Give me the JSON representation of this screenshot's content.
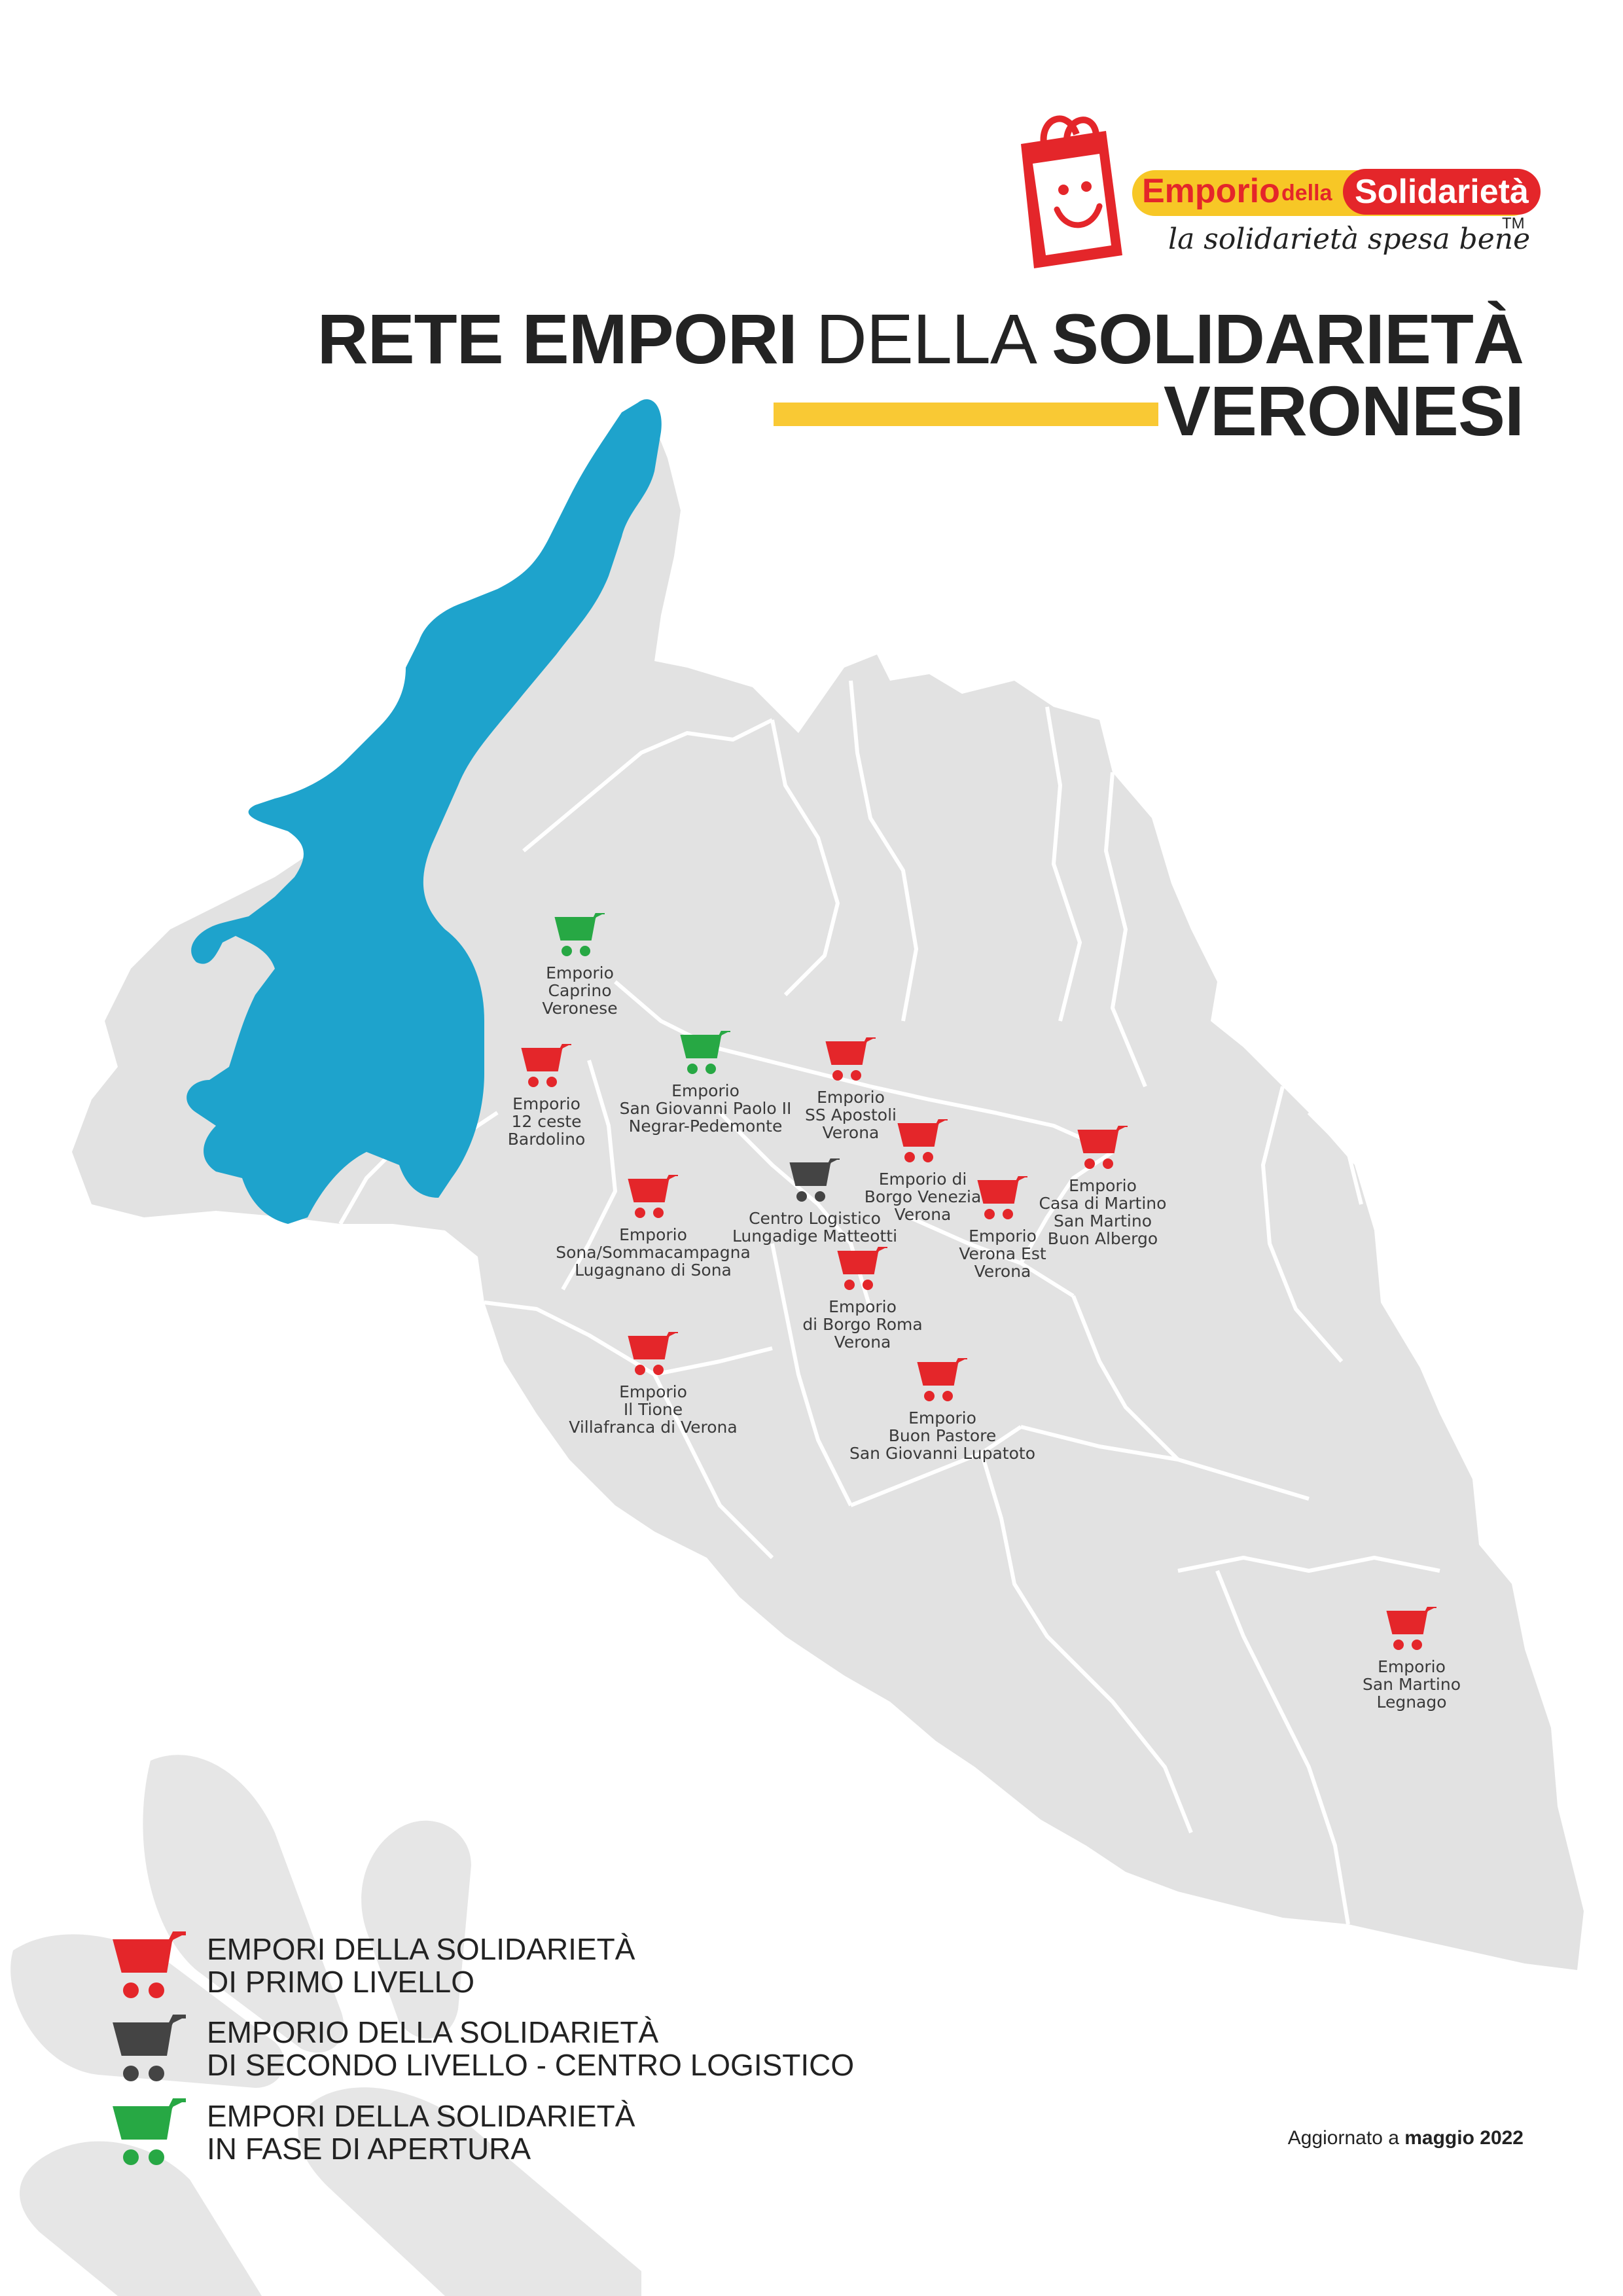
{
  "brand": {
    "word_emporio": "Emporio",
    "word_della": "della",
    "word_solidarieta": "Solidarietà",
    "tagline": "la solidarietà spesa bene",
    "trademark": "TM"
  },
  "title": {
    "line1_bold_a": "RETE EMPORI",
    "line1_light": "DELLA",
    "line1_bold_b": "SOLIDARIETÀ",
    "line2": "VERONESI"
  },
  "colors": {
    "primo_livello": "#e4262a",
    "secondo_livello": "#444444",
    "in_apertura": "#27a844",
    "lake": "#1ea3cc",
    "land": "#e2e2e2",
    "accent_bar": "#f9c934"
  },
  "locations": [
    {
      "level": "in_apertura",
      "lines": [
        "Emporio",
        "Caprino",
        "Veronese"
      ]
    },
    {
      "level": "primo_livello",
      "lines": [
        "Emporio",
        "12 ceste",
        "Bardolino"
      ]
    },
    {
      "level": "in_apertura",
      "lines": [
        "Emporio",
        "San Giovanni Paolo II",
        "Negrar-Pedemonte"
      ]
    },
    {
      "level": "primo_livello",
      "lines": [
        "Emporio",
        "SS Apostoli",
        "Verona"
      ]
    },
    {
      "level": "primo_livello",
      "lines": [
        "Emporio di",
        "Borgo Venezia",
        "Verona"
      ]
    },
    {
      "level": "primo_livello",
      "lines": [
        "Emporio",
        "Casa di Martino",
        "San Martino",
        "Buon Albergo"
      ]
    },
    {
      "level": "secondo_livello",
      "lines": [
        "Centro Logistico",
        "Lungadige Matteotti"
      ]
    },
    {
      "level": "primo_livello",
      "lines": [
        "Emporio",
        "Sona/Sommacampagna",
        "Lugagnano di Sona"
      ]
    },
    {
      "level": "primo_livello",
      "lines": [
        "Emporio",
        "Verona Est",
        "Verona"
      ]
    },
    {
      "level": "primo_livello",
      "lines": [
        "Emporio",
        "di Borgo Roma",
        "Verona"
      ]
    },
    {
      "level": "primo_livello",
      "lines": [
        "Emporio",
        "Il Tione",
        "Villafranca di Verona"
      ]
    },
    {
      "level": "primo_livello",
      "lines": [
        "Emporio",
        "Buon Pastore",
        "San Giovanni Lupatoto"
      ]
    },
    {
      "level": "primo_livello",
      "lines": [
        "Emporio",
        "San Martino",
        "Legnago"
      ]
    }
  ],
  "legend": [
    {
      "level": "primo_livello",
      "icon": "cart-icon-red",
      "lines": [
        "EMPORI DELLA SOLIDARIETÀ",
        "DI PRIMO LIVELLO"
      ]
    },
    {
      "level": "secondo_livello",
      "icon": "cart-icon-dark",
      "lines": [
        "EMPORIO DELLA SOLIDARIETÀ",
        "DI SECONDO LIVELLO - CENTRO LOGISTICO"
      ]
    },
    {
      "level": "in_apertura",
      "icon": "cart-icon-green",
      "lines": [
        "EMPORI DELLA SOLIDARIETÀ",
        "IN FASE DI APERTURA"
      ]
    }
  ],
  "footer": {
    "updated_prefix": "Aggiornato a",
    "updated_date": "maggio 2022"
  }
}
